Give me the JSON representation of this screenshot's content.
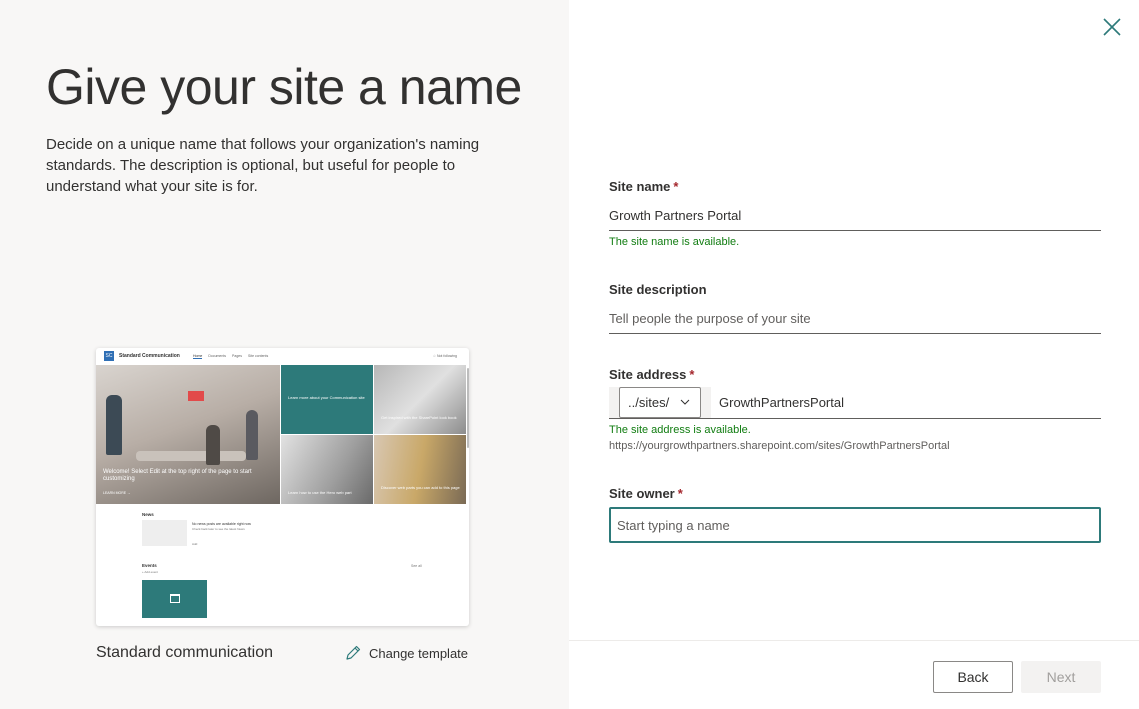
{
  "left": {
    "title": "Give your site a name",
    "subtitle": "Decide on a unique name that follows your organization's naming standards. The description is optional, but useful for people to understand what your site is for.",
    "preview": {
      "logo_text": "SC",
      "site_name": "Standard Communication",
      "nav": [
        "Home",
        "Documents",
        "Pages",
        "Site contents"
      ],
      "follow": "☆ Not following",
      "hero_text": "Welcome! Select Edit at the top right of the page to start customizing",
      "hero_link": "LEARN MORE →",
      "tile1": "Learn more about your Communication site",
      "tile2": "Get inspired with the SharePoint look book",
      "tile3": "Learn how to use the Hero web part",
      "tile4": "Discover web parts you can add to this page",
      "news_title": "News",
      "news_text": "No news posts are available right now",
      "news_sub": "Check back later to see the latest News",
      "news_add": "Add",
      "events_title": "Events",
      "events_sub": "+ Add event",
      "see_all": "See all"
    },
    "template_name": "Standard communication",
    "change_template": "Change template"
  },
  "form": {
    "site_name": {
      "label": "Site name",
      "required_mark": "*",
      "value": "Growth Partners Portal",
      "status": "The site name is available."
    },
    "site_description": {
      "label": "Site description",
      "placeholder": "Tell people the purpose of your site",
      "value": ""
    },
    "site_address": {
      "label": "Site address",
      "required_mark": "*",
      "prefix": "../sites/",
      "value": "GrowthPartnersPortal",
      "status": "The site address is available.",
      "full_url": "https://yourgrowthpartners.sharepoint.com/sites/GrowthPartnersPortal"
    },
    "site_owner": {
      "label": "Site owner",
      "required_mark": "*",
      "placeholder": "Start typing a name",
      "value": ""
    }
  },
  "footer": {
    "back_label": "Back",
    "next_label": "Next"
  },
  "icons": {
    "close": "close-icon",
    "pencil": "pencil-icon",
    "chevron": "chevron-down-icon",
    "calendar": "calendar-icon"
  },
  "colors": {
    "accent": "#2d7a7a",
    "success": "#107c10",
    "required": "#a4262c",
    "left_bg": "#f8f7f6"
  }
}
